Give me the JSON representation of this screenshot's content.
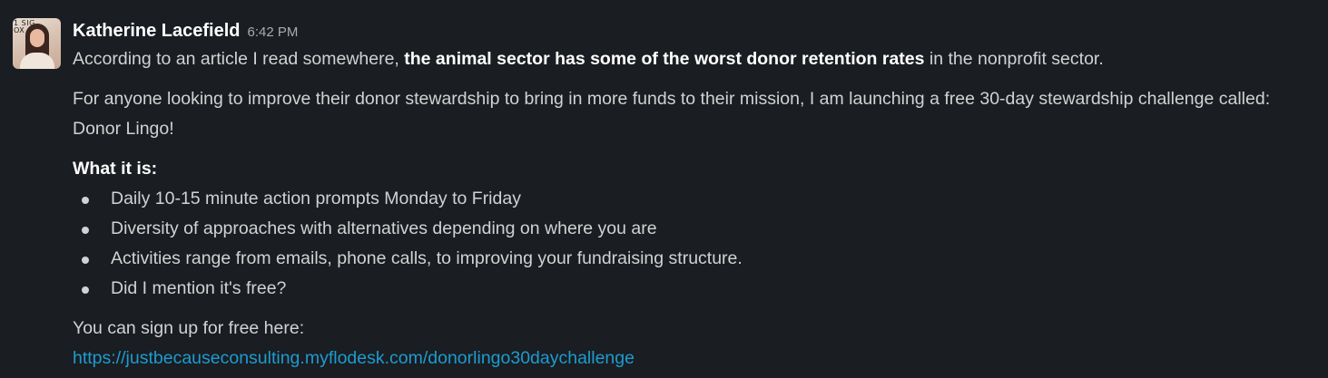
{
  "message": {
    "author": "Katherine Lacefield",
    "time": "6:42 PM",
    "avatar_mark": "1 SIG\nOX",
    "intro": {
      "before": "According to an article I read somewhere, ",
      "bold": "the animal sector has some of the worst donor retention rates",
      "after": " in the nonprofit sector."
    },
    "paragraph2": "For anyone looking to improve their donor stewardship to bring in more funds to their mission, I am launching a free 30-day stewardship challenge called: Donor Lingo!",
    "what_heading": "What it is:",
    "bullets": [
      "Daily 10-15 minute action prompts Monday to Friday",
      "Diversity of approaches with alternatives depending on where you are",
      "Activities range from emails, phone calls, to improving your fundraising structure.",
      "Did I mention it's free?"
    ],
    "signup_text": "You can sign up for free here:",
    "signup_link": "https://justbecauseconsulting.myflodesk.com/donorlingo30daychallenge"
  },
  "colors": {
    "background": "#1a1d21",
    "text": "#d1d2d3",
    "link": "#1d9bd1",
    "timestamp": "#ababad"
  }
}
